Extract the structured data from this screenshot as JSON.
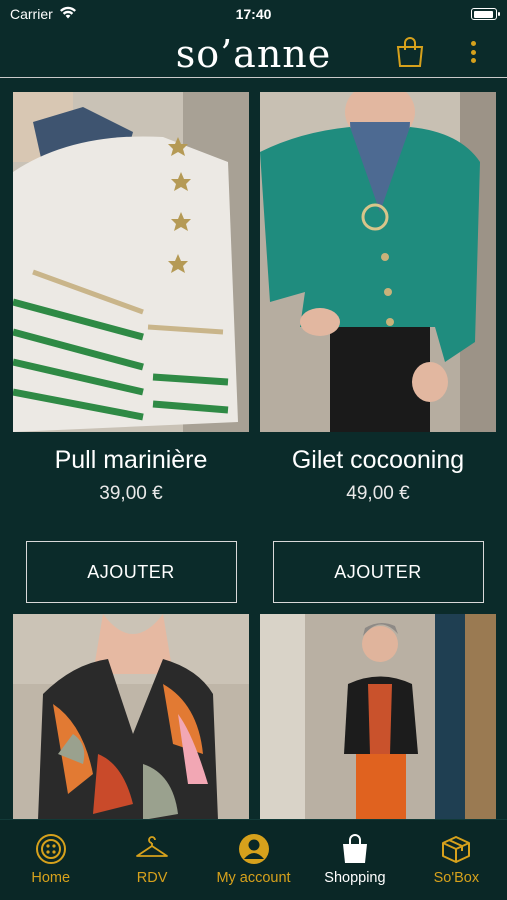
{
  "status_bar": {
    "carrier": "Carrier",
    "time": "17:40",
    "battery_level": 0.95
  },
  "header": {
    "logo": "so’anne",
    "cart_icon": "shopping-bag-icon",
    "menu_icon": "more-vertical-icon"
  },
  "colors": {
    "background": "#0b2b2a",
    "accent": "#d6a11c",
    "text": "#ffffff"
  },
  "products": [
    {
      "name": "Pull marinière",
      "price": "39,00 €",
      "button": "AJOUTER"
    },
    {
      "name": "Gilet cocooning",
      "price": "49,00 €",
      "button": "AJOUTER"
    },
    {
      "name": "",
      "price": "",
      "button": ""
    },
    {
      "name": "",
      "price": "",
      "button": ""
    }
  ],
  "tabs": [
    {
      "label": "Home",
      "icon": "button-icon",
      "active": false
    },
    {
      "label": "RDV",
      "icon": "hanger-icon",
      "active": false
    },
    {
      "label": "My account",
      "icon": "user-icon",
      "active": false
    },
    {
      "label": "Shopping",
      "icon": "shopping-bag-icon",
      "active": true
    },
    {
      "label": "So'Box",
      "icon": "box-icon",
      "active": false
    }
  ]
}
